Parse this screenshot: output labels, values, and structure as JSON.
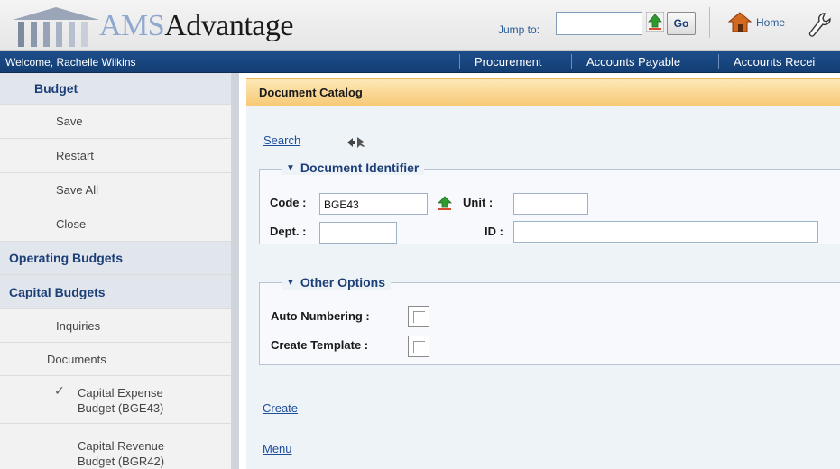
{
  "header": {
    "logo_prefix": "AMS",
    "logo_suffix": "Advantage",
    "jump_label": "Jump to:",
    "jump_value": "",
    "go_label": "Go",
    "home_label": "Home"
  },
  "navbar": {
    "welcome": "Welcome, Rachelle Wilkins",
    "links": [
      "Procurement",
      "Accounts Payable",
      "Accounts Recei"
    ]
  },
  "sidebar": {
    "budget": "Budget",
    "save": "Save",
    "restart": "Restart",
    "save_all": "Save All",
    "close": "Close",
    "operating_budgets": "Operating Budgets",
    "capital_budgets": "Capital Budgets",
    "inquiries": "Inquiries",
    "documents": "Documents",
    "doc1_line1": "Capital Expense",
    "doc1_line2": "Budget (BGE43)",
    "doc2_line1": "Capital Revenue",
    "doc2_line2": "Budget (BGR42)",
    "check_mark": "✓"
  },
  "main": {
    "title": "Document Catalog",
    "search_link": "Search",
    "doc_identifier": {
      "legend": "Document Identifier",
      "code_label": "Code :",
      "code_value": "BGE43",
      "unit_label": "Unit :",
      "unit_value": "",
      "dept_label": "Dept. :",
      "dept_value": "",
      "id_label": "ID :",
      "id_value": ""
    },
    "other_options": {
      "legend": "Other Options",
      "auto_numbering_label": "Auto Numbering :",
      "auto_numbering_checked": false,
      "create_template_label": "Create Template :",
      "create_template_checked": false
    },
    "create_link": "Create",
    "menu_link": "Menu"
  },
  "colors": {
    "nav_blue": "#1e4e8c",
    "link_blue": "#1d4e9a",
    "catalog_orange": "#f7c977",
    "heading_blue": "#1d3f78"
  },
  "icons": [
    "columns-logo-icon",
    "upload-arrow-icon",
    "home-icon",
    "wrench-icon",
    "expand-arrows-icon",
    "triangle-down-icon",
    "checkmark-icon"
  ]
}
